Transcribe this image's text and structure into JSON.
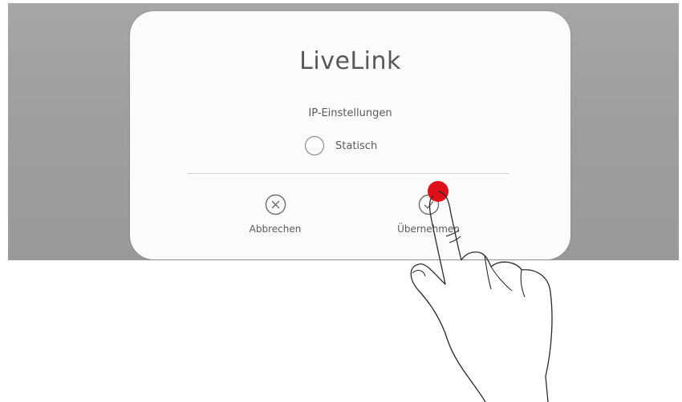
{
  "dialog": {
    "title": "LiveLink",
    "section_label": "IP-Einstellungen",
    "radio_option_label": "Statisch",
    "cancel_label": "Abbrechen",
    "apply_label": "Übernehmen"
  },
  "icons": {
    "cancel": "close-circle-icon",
    "apply": "check-circle-icon",
    "pointer": "hand-pointer-icon"
  },
  "colors": {
    "touch_indicator": "#e0101a",
    "background": "#a0a0a0",
    "dialog": "#fbfbfb"
  }
}
